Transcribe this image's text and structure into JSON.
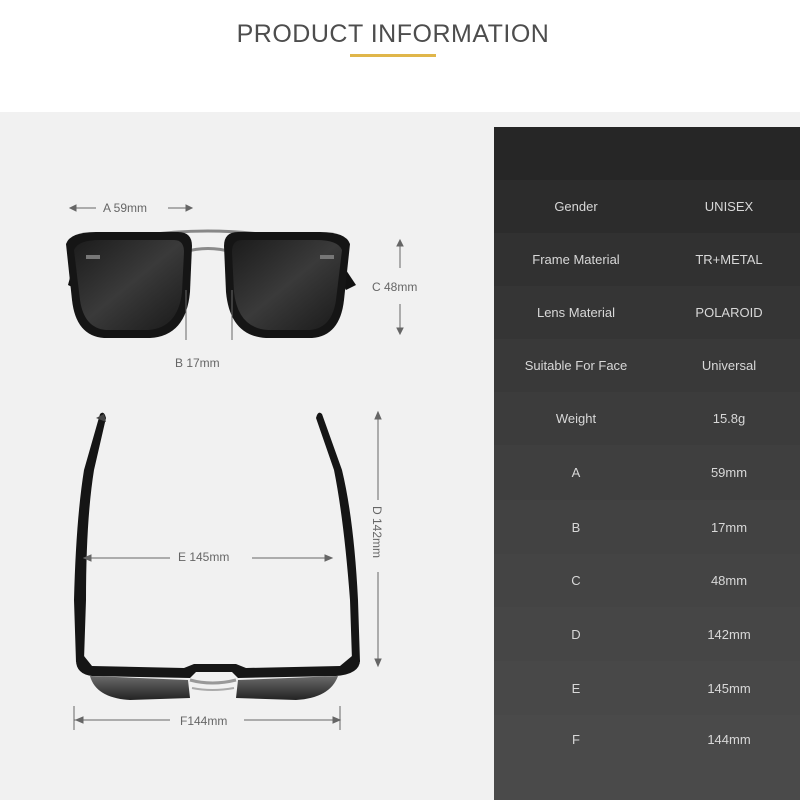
{
  "header": {
    "title": "PRODUCT INFORMATION"
  },
  "dimensions": {
    "a": "A 59mm",
    "b": "B 17mm",
    "c": "C 48mm",
    "d": "D 142mm",
    "e": "E 145mm",
    "f": "F144mm"
  },
  "specs": [
    {
      "label": "Gender",
      "value": "UNISEX"
    },
    {
      "label": "Frame Material",
      "value": "TR+METAL"
    },
    {
      "label": "Lens Material",
      "value": "POLAROID"
    },
    {
      "label": "Suitable For Face",
      "value": "Universal"
    },
    {
      "label": "Weight",
      "value": "15.8g"
    },
    {
      "label": "A",
      "value": "59mm"
    },
    {
      "label": "B",
      "value": "17mm"
    },
    {
      "label": "C",
      "value": "48mm"
    },
    {
      "label": "D",
      "value": "142mm"
    },
    {
      "label": "E",
      "value": "145mm"
    },
    {
      "label": "F",
      "value": "144mm"
    }
  ],
  "colors": {
    "accent": "#e0b64a",
    "header_text": "#4d4d4d",
    "panel_dark": "#262626",
    "panel_light": "#4a4a4a",
    "background": "#f1f1f1"
  }
}
